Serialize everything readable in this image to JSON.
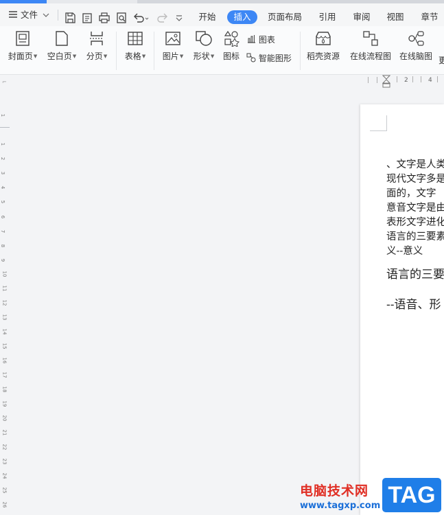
{
  "menu": {
    "file_label": "文件",
    "tabs": [
      {
        "label": "开始"
      },
      {
        "label": "插入"
      },
      {
        "label": "页面布局"
      },
      {
        "label": "引用"
      },
      {
        "label": "审阅"
      },
      {
        "label": "视图"
      },
      {
        "label": "章节"
      }
    ],
    "active_tab": "插入"
  },
  "ribbon": {
    "cover": "封面页",
    "blank": "空白页",
    "pagebreak": "分页",
    "table": "表格",
    "picture": "图片",
    "shape": "形状",
    "icon": "图标",
    "chart": "图表",
    "smartart": "智能图形",
    "resources": "稻壳资源",
    "flowchart": "在线流程图",
    "mindmap": "在线脑图",
    "more": "更"
  },
  "ruler": {
    "h_ticks": [
      "2",
      "4"
    ],
    "v_numbers": [
      "1",
      "1",
      "2",
      "3",
      "4",
      "5",
      "6",
      "7",
      "8",
      "9",
      "10",
      "11",
      "12",
      "13",
      "14",
      "15",
      "16",
      "17",
      "18",
      "19",
      "20",
      "21",
      "22",
      "23",
      "24",
      "25",
      "26"
    ]
  },
  "document": {
    "lines": [
      "、文字是人类",
      "现代文字多是",
      "面的，文字",
      "意音文字是由",
      "表形文字进化",
      "语言的三要素",
      "义--意义"
    ],
    "para2": "语言的三要",
    "para3": "--语音、形"
  },
  "watermark": {
    "site_name": "电脑技术网",
    "url": "www.tagxp.com",
    "badge": "TAG"
  },
  "colors": {
    "accent": "#3d87f5",
    "watermark_red": "#e02e24",
    "watermark_blue": "#1f7ee8"
  }
}
